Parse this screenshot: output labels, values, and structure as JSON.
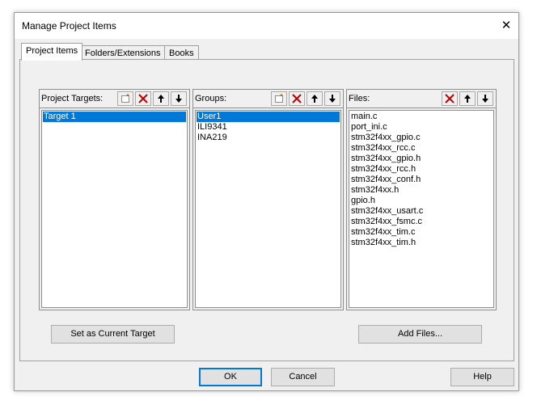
{
  "window": {
    "title": "Manage Project Items",
    "close_glyph": "✕"
  },
  "tabs": [
    {
      "label": "Project Items",
      "active": true
    },
    {
      "label": "Folders/Extensions",
      "active": false
    },
    {
      "label": "Books",
      "active": false
    }
  ],
  "targets": {
    "label": "Project Targets:",
    "items": [
      "Target 1"
    ],
    "selected": 0
  },
  "groups": {
    "label": "Groups:",
    "items": [
      "User1",
      "ILI9341",
      "INA219"
    ],
    "selected": 0
  },
  "files": {
    "label": "Files:",
    "items": [
      "main.c",
      "port_ini.c",
      "stm32f4xx_gpio.c",
      "stm32f4xx_rcc.c",
      "stm32f4xx_gpio.h",
      "stm32f4xx_rcc.h",
      "stm32f4xx_conf.h",
      "stm32f4xx.h",
      "gpio.h",
      "stm32f4xx_usart.c",
      "stm32f4xx_fsmc.c",
      "stm32f4xx_tim.c",
      "stm32f4xx_tim.h"
    ]
  },
  "buttons": {
    "set_current_target": "Set as Current Target",
    "add_files": "Add Files...",
    "ok": "OK",
    "cancel": "Cancel",
    "help": "Help"
  },
  "colors": {
    "selection": "#0078d7",
    "delete_icon": "#c00000"
  },
  "icons": [
    "new-item-icon",
    "delete-icon",
    "move-up-icon",
    "move-down-icon",
    "close-icon"
  ]
}
